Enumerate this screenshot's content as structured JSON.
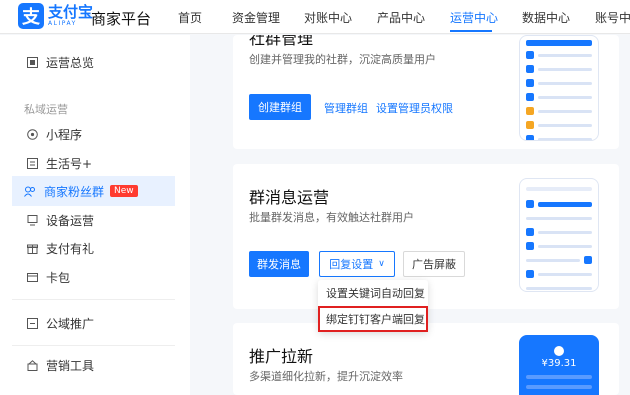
{
  "brand": {
    "cn": "支付宝",
    "en": "ALIPAY",
    "platform": "商家平台"
  },
  "nav": {
    "items": [
      "首页",
      "资金管理",
      "对账中心",
      "产品中心",
      "运营中心",
      "数据中心",
      "账号中心"
    ],
    "active": "运营中心"
  },
  "sidebar": {
    "top_item": "运营总览",
    "group_label": "私域运营",
    "items": [
      "小程序",
      "生活号+",
      "商家粉丝群",
      "设备运营",
      "支付有礼",
      "卡包"
    ],
    "active_item": "商家粉丝群",
    "new_badge": "New",
    "bottom_items": [
      "公域推广",
      "营销工具"
    ]
  },
  "cards": {
    "community": {
      "title": "社群管理",
      "desc": "创建并管理我的社群，沉淀高质量用户",
      "create_btn": "创建群组",
      "manage_link": "管理群组",
      "admin_link": "设置管理员权限"
    },
    "messages": {
      "title": "群消息运营",
      "desc": "批量群发消息，有效触达社群用户",
      "send_btn": "群发消息",
      "reply_btn": "回复设置",
      "ad_btn": "广告屏蔽"
    },
    "promotion": {
      "title": "推广拉新",
      "desc": "多渠道细化拉新，提升沉淀效率"
    }
  },
  "dropdown": {
    "items": [
      "设置关键词自动回复",
      "绑定钉钉客户端回复"
    ],
    "highlighted": "绑定钉钉客户端回复"
  },
  "phone_price": "¥39.31",
  "colors": {
    "primary": "#1677ff",
    "highlight": "#e02020",
    "badge": "#ff3b30"
  }
}
